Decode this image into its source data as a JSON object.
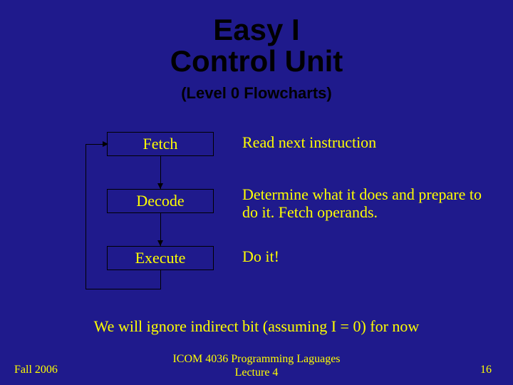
{
  "title": {
    "line1": "Easy I",
    "line2": "Control Unit"
  },
  "subtitle": "(Level 0 Flowcharts)",
  "steps": [
    {
      "name": "Fetch",
      "desc": "Read next instruction"
    },
    {
      "name": "Decode",
      "desc": "Determine what it does and prepare to do it. Fetch operands."
    },
    {
      "name": "Execute",
      "desc": "Do it!"
    }
  ],
  "note": "We will ignore indirect bit (assuming I = 0) for now",
  "footer": {
    "left": "Fall 2006",
    "center_line1": "ICOM 4036 Programming Laguages",
    "center_line2": "Lecture 4",
    "right": "16"
  }
}
